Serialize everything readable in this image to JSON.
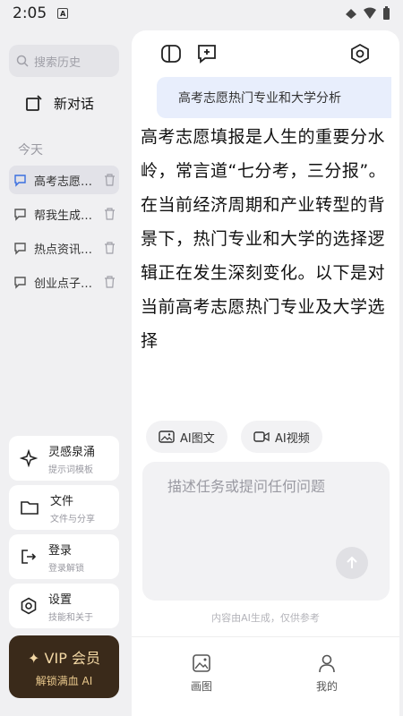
{
  "status": {
    "time": "2:05",
    "notif_glyph": "A"
  },
  "sidebar": {
    "search_placeholder": "搜索历史",
    "new_chat": "新对话",
    "section_today": "今天",
    "conversations": [
      {
        "label": "高考志愿热门专业和大学分析",
        "active": true
      },
      {
        "label": "帮我生成一份计划",
        "active": false
      },
      {
        "label": "热点资讯速览",
        "active": false
      },
      {
        "label": "创业点子推荐",
        "active": false
      }
    ],
    "tools": [
      {
        "title": "灵感泉涌",
        "subtitle": "提示词模板",
        "icon": "sparkle-icon"
      },
      {
        "title": "文件",
        "subtitle": "文件与分享",
        "icon": "folder-icon"
      },
      {
        "title": "登录",
        "subtitle": "登录解锁",
        "icon": "login-icon"
      },
      {
        "title": "设置",
        "subtitle": "技能和关于",
        "icon": "settings-icon"
      }
    ],
    "vip": {
      "title": "VIP 会员",
      "subtitle": "解锁满血 AI"
    }
  },
  "main": {
    "user_message": "高考志愿热门专业和大学分析",
    "answer": "高考志愿填报是人生的重要分水岭，常言道“七分考，三分报”。在当前经济周期和产业转型的背景下，热门专业和大学的选择逻辑正在发生深刻变化。以下是对当前高考志愿热门专业及大学选择",
    "chips": [
      {
        "label": "AI图文",
        "icon": "image-icon"
      },
      {
        "label": "AI视频",
        "icon": "video-icon"
      }
    ],
    "input_placeholder": "描述任务或提问任何问题",
    "disclaimer": "内容由AI生成，仅供参考"
  },
  "bottom_nav": [
    {
      "label": "画图",
      "icon": "picture-icon"
    },
    {
      "label": "我的",
      "icon": "user-icon"
    }
  ],
  "colors": {
    "background": "#f0f0f2",
    "user_bubble": "#e8eefc",
    "vip_bg": "#3a2a1a",
    "vip_text": "#f3d8a5"
  }
}
